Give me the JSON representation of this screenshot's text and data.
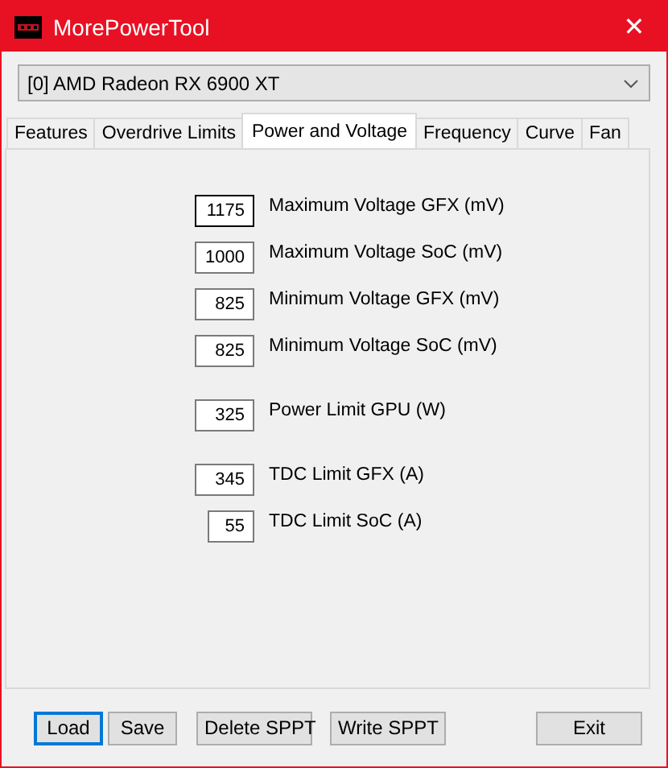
{
  "window": {
    "title": "MorePowerTool",
    "close": "✕"
  },
  "device": {
    "value": "[0] AMD Radeon RX 6900 XT"
  },
  "tabs": [
    {
      "label": "Features",
      "selected": false
    },
    {
      "label": "Overdrive Limits",
      "selected": false
    },
    {
      "label": "Power and Voltage",
      "selected": true
    },
    {
      "label": "Frequency",
      "selected": false
    },
    {
      "label": "Curve",
      "selected": false
    },
    {
      "label": "Fan",
      "selected": false
    }
  ],
  "groups": [
    [
      {
        "value": "1175",
        "label": "Maximum Voltage GFX (mV)",
        "focused": true
      },
      {
        "value": "1000",
        "label": "Maximum Voltage SoC (mV)",
        "focused": false
      },
      {
        "value": "825",
        "label": "Minimum Voltage GFX (mV)",
        "focused": false
      },
      {
        "value": "825",
        "label": "Minimum Voltage SoC (mV)",
        "focused": false
      }
    ],
    [
      {
        "value": "325",
        "label": "Power Limit GPU (W)",
        "focused": false
      }
    ],
    [
      {
        "value": "345",
        "label": "TDC Limit GFX (A)",
        "focused": false
      },
      {
        "value": "55",
        "label": "TDC Limit SoC (A)",
        "focused": false,
        "kind": "narrow"
      }
    ]
  ],
  "buttons": [
    {
      "label": "Load",
      "focused": true
    },
    {
      "label": "Save",
      "focused": false
    },
    {
      "label": "Delete SPPT",
      "focused": false
    },
    {
      "label": "Write SPPT",
      "focused": false
    },
    {
      "label": "Exit",
      "focused": false
    }
  ]
}
